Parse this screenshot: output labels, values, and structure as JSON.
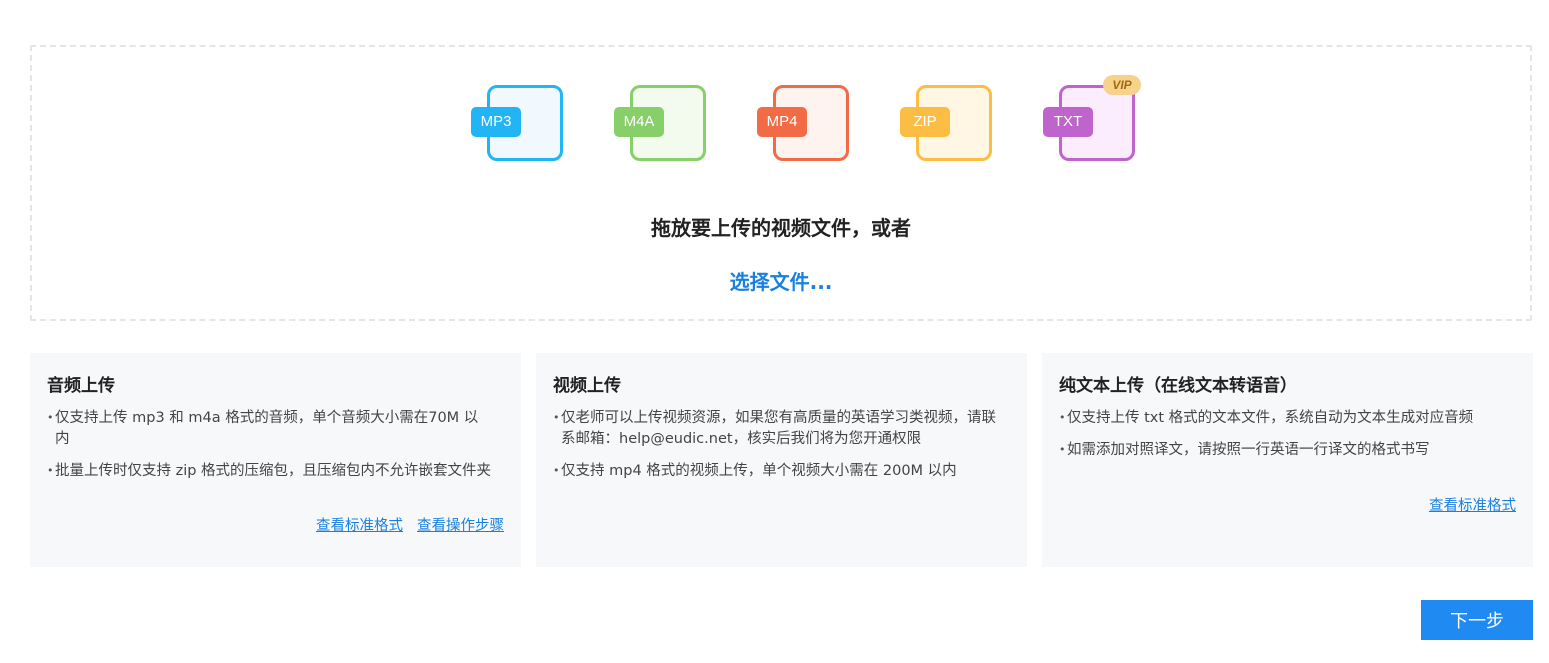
{
  "upload": {
    "formats": [
      {
        "label": "MP3",
        "tag_color": "#21b5f5",
        "frame_color": "#21b5f5",
        "fill_color": "#f1f9ff",
        "vip": false
      },
      {
        "label": "M4A",
        "tag_color": "#86cf69",
        "frame_color": "#86cf69",
        "fill_color": "#f3fbee",
        "vip": false
      },
      {
        "label": "MP4",
        "tag_color": "#f16c46",
        "frame_color": "#f16c46",
        "fill_color": "#fff3ef",
        "vip": false
      },
      {
        "label": "ZIP",
        "tag_color": "#fcbd45",
        "frame_color": "#fcbd45",
        "fill_color": "#fff6e3",
        "vip": false
      },
      {
        "label": "TXT",
        "tag_color": "#bf64cc",
        "frame_color": "#bf64cc",
        "fill_color": "#fbecfe",
        "vip": true
      }
    ],
    "vip_label": "VIP",
    "drop_title": "拖放要上传的视频文件，或者",
    "choose_file": "选择文件..."
  },
  "cards": [
    {
      "title": "音频上传",
      "items": [
        "仅支持上传 mp3 和 m4a 格式的音频，单个音频大小需在70M 以内",
        "批量上传时仅支持 zip 格式的压缩包，且压缩包内不允许嵌套文件夹"
      ],
      "links": [
        "查看标准格式",
        "查看操作步骤"
      ]
    },
    {
      "title": "视频上传",
      "items": [
        "仅老师可以上传视频资源，如果您有高质量的英语学习类视频，请联系邮箱：help@eudic.net，核实后我们将为您开通权限",
        "仅支持 mp4 格式的视频上传，单个视频大小需在 200M 以内"
      ],
      "links": []
    },
    {
      "title": "纯文本上传（在线文本转语音）",
      "items": [
        "仅支持上传 txt 格式的文本文件，系统自动为文本生成对应音频",
        "如需添加对照译文，请按照一行英语一行译文的格式书写"
      ],
      "links": [
        "查看标准格式"
      ]
    }
  ],
  "next_button": "下一步",
  "accent_color": "#1a80e0"
}
